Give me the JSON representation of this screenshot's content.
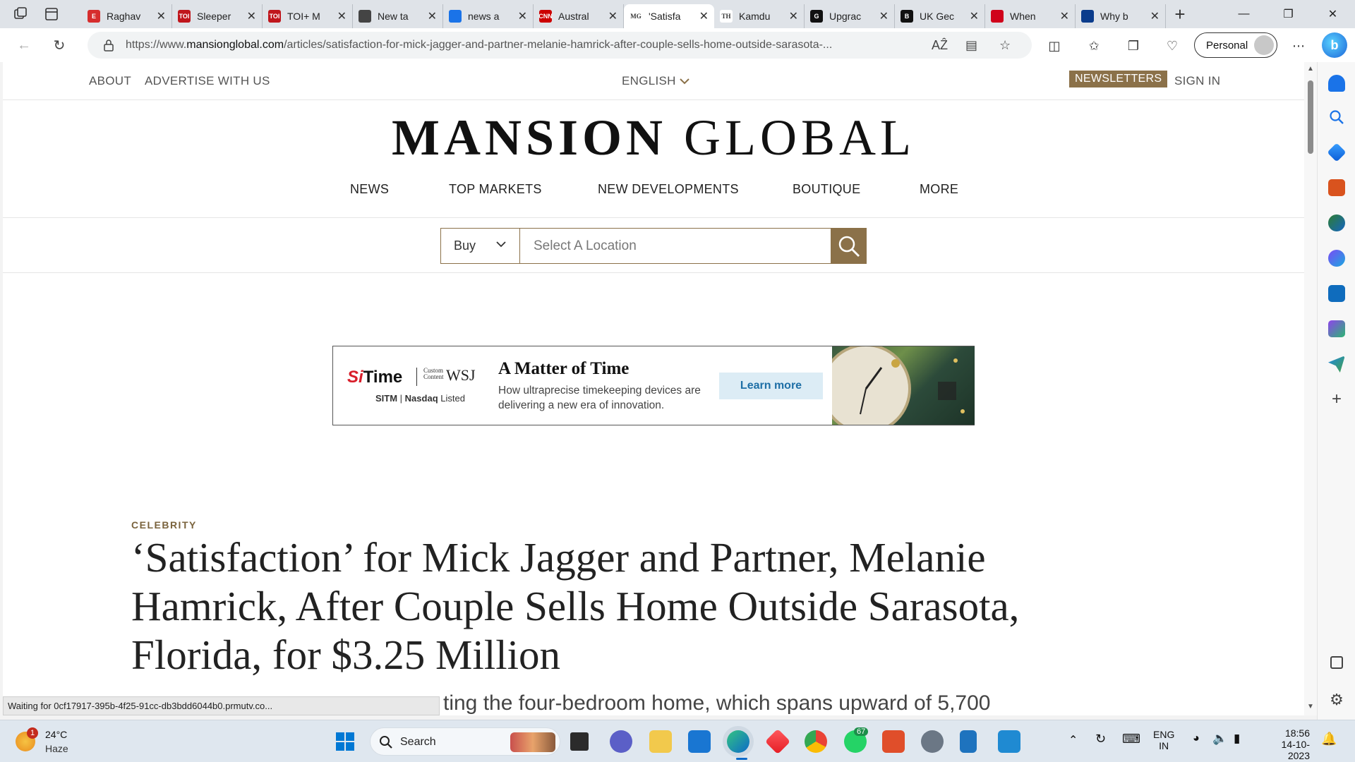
{
  "browser": {
    "tabs": [
      {
        "title": "Raghav",
        "favicon": "E",
        "color": "#d62d2d"
      },
      {
        "title": "Sleeper",
        "favicon": "TOI",
        "color": "#c0161c"
      },
      {
        "title": "TOI+ M",
        "favicon": "TOI",
        "color": "#c0161c"
      },
      {
        "title": "New ta",
        "favicon": "newtab-icon",
        "color": "#444444"
      },
      {
        "title": "news a",
        "favicon": "search-icon",
        "color": "#1a73e8"
      },
      {
        "title": "Austral",
        "favicon": "CNN",
        "color": "#cc0000"
      },
      {
        "title": "'Satisfa",
        "favicon": "MG",
        "color": "#ffffff",
        "active": true
      },
      {
        "title": "Kamdu",
        "favicon": "TH",
        "color": "#ffffff"
      },
      {
        "title": "Upgrac",
        "favicon": "G",
        "color": "#111111"
      },
      {
        "title": "UK Gec",
        "favicon": "B",
        "color": "#111111"
      },
      {
        "title": "When",
        "favicon": "diamond-icon",
        "color": "#d0021b"
      },
      {
        "title": "Why b",
        "favicon": "news-icon",
        "color": "#0b3c8c"
      }
    ],
    "url_prefix": "https://www.",
    "url_host": "mansionglobal.com",
    "url_path": "/articles/satisfaction-for-mick-jagger-and-partner-melanie-hamrick-after-couple-sells-home-outside-sarasota-...",
    "profile_label": "Personal",
    "status_text": "Waiting for 0cf17917-395b-4f25-91cc-db3bdd6044b0.prmutv.co..."
  },
  "site": {
    "util_links": {
      "about": "ABOUT",
      "advertise": "ADVERTISE WITH US",
      "language": "ENGLISH",
      "newsletters": "NEWSLETTERS",
      "signin": "SIGN IN"
    },
    "logo_bold": "MANSION",
    "logo_light": "GLOBAL",
    "nav": {
      "news": "NEWS",
      "top_markets": "TOP MARKETS",
      "new_developments": "NEW DEVELOPMENTS",
      "boutique": "BOUTIQUE",
      "more": "MORE"
    },
    "search": {
      "mode": "Buy",
      "placeholder": "Select A Location"
    }
  },
  "ad": {
    "brand_si": "Si",
    "brand_rest": "Time",
    "custom_content_1": "Custom",
    "custom_content_2": "Content",
    "wsj": "WSJ",
    "ticker_symbol": "SITM",
    "ticker_exchange": "Nasdaq",
    "ticker_listed": "Listed",
    "headline": "A Matter of Time",
    "sub": "How ultraprecise timekeeping devices are delivering a new era of innovation.",
    "cta": "Learn more"
  },
  "article": {
    "kicker": "CELEBRITY",
    "title": "‘Satisfaction’ for Mick Jagger and Partner, Melanie Hamrick, After Couple Sells Home Outside Sarasota, Florida, for $3.25 Million",
    "dek_visible": "ting the four-bedroom home, which spans upward of 5,700"
  },
  "taskbar": {
    "weather_temp": "24°C",
    "weather_cond": "Haze",
    "weather_badge": "1",
    "search_label": "Search",
    "whatsapp_badge": "67",
    "lang_1": "ENG",
    "lang_2": "IN",
    "time": "18:56",
    "date": "14-10-2023"
  }
}
